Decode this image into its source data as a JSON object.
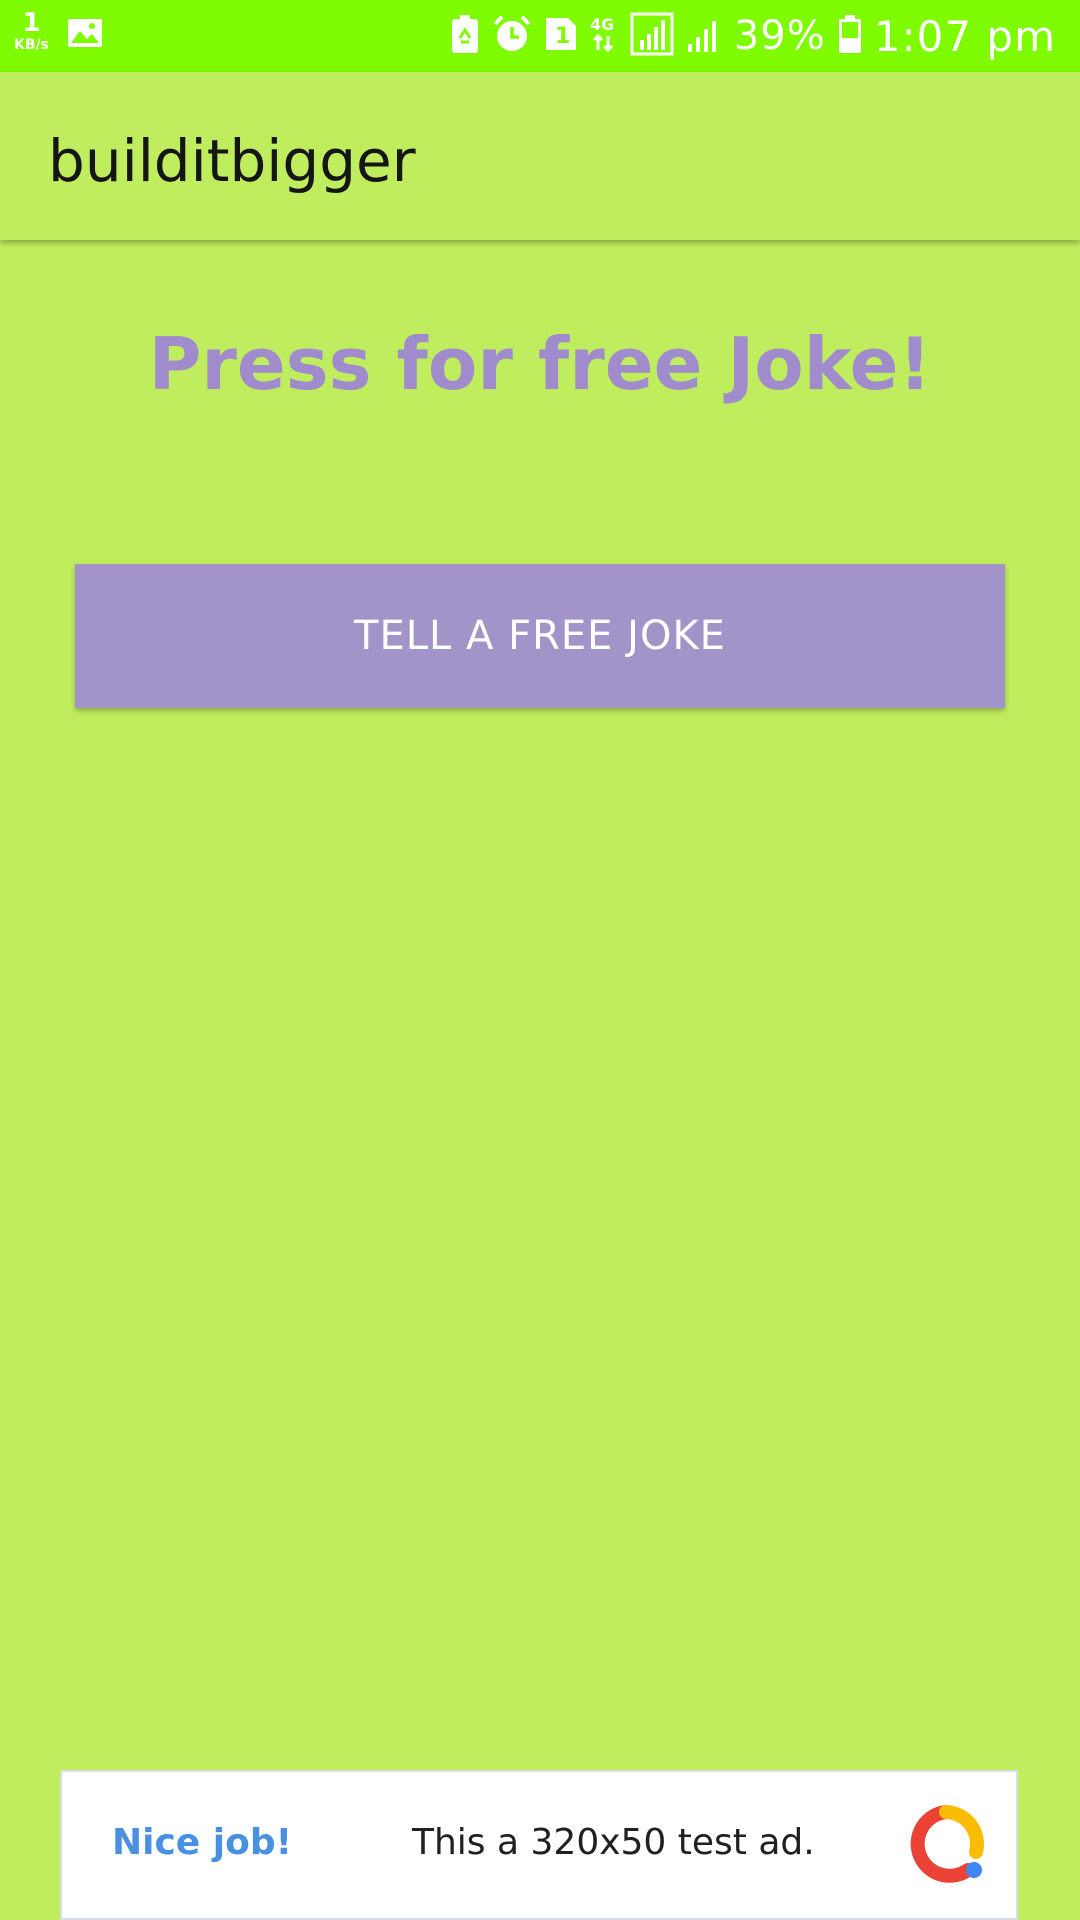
{
  "status_bar": {
    "speed_value": "1",
    "speed_unit": "KB/s",
    "sim_label": "1",
    "network_label": "4G",
    "battery_percent": "39%",
    "time": "1:07 pm",
    "background_color": "#7ffb00",
    "icons": [
      "speed-indicator",
      "image-icon",
      "battery-saver-icon",
      "alarm-icon",
      "sim-icon",
      "network-4g-icon",
      "signal-icon",
      "signal-icon-2",
      "battery-icon"
    ]
  },
  "app_bar": {
    "title": "builditbigger"
  },
  "main": {
    "headline": "Press for free Joke!",
    "button_label": "TELL A FREE JOKE",
    "accent_color": "#a293c9",
    "background_color": "#c0ed5e"
  },
  "ad": {
    "nice_text": "Nice job!",
    "ad_text": "This a 320x50 test ad.",
    "logo": "google-ad-logo"
  }
}
